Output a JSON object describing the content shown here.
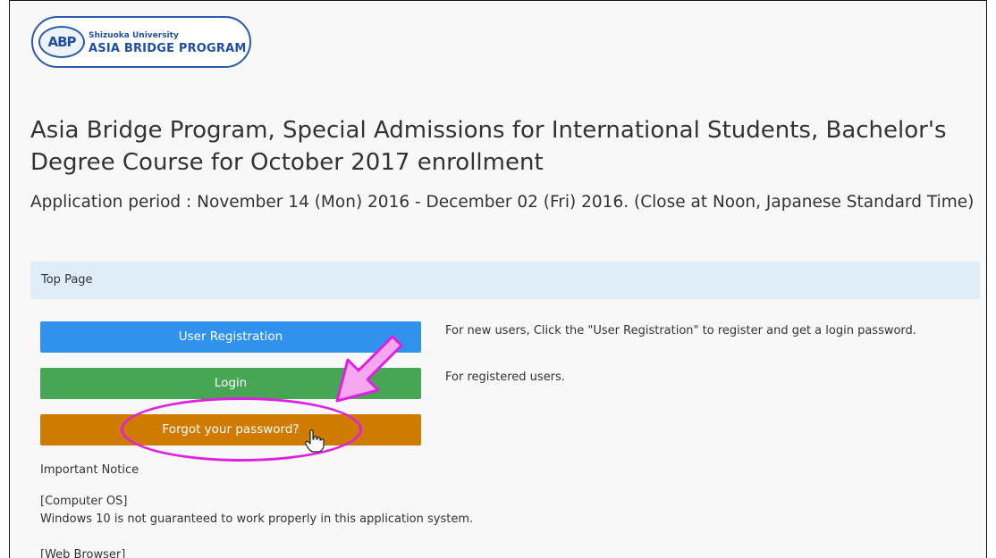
{
  "logo": {
    "mark": "ABP",
    "subtitle": "Shizuoka University",
    "name": "ASIA BRIDGE PROGRAM",
    "color": "#1f4f9f"
  },
  "page": {
    "title": "Asia Bridge Program, Special Admissions for International Students, Bachelor's Degree Course for October 2017 enrollment",
    "period": "Application period : November 14 (Mon) 2016 - December 02 (Fri) 2016. (Close at Noon, Japanese Standard Time)"
  },
  "breadcrumb": {
    "label": "Top Page"
  },
  "actions": {
    "registration": {
      "label": "User Registration",
      "description": "For new users, Click the \"User Registration\" to register and get a login password.",
      "color": "#2f93ee"
    },
    "login": {
      "label": "Login",
      "description": "For registered users.",
      "color": "#46a653"
    },
    "forgot": {
      "label": "Forgot your password?",
      "color": "#cf7a00"
    }
  },
  "notice": {
    "heading": "Important Notice",
    "os_label": "[Computer OS]",
    "os_text": "Windows 10 is not guaranteed to work properly in this application system.",
    "browser_label": "[Web Browser]"
  },
  "annotation": {
    "color": "#e020e0",
    "icons": [
      "pointer-arrow-icon",
      "highlight-ellipse",
      "hand-cursor-icon"
    ]
  }
}
